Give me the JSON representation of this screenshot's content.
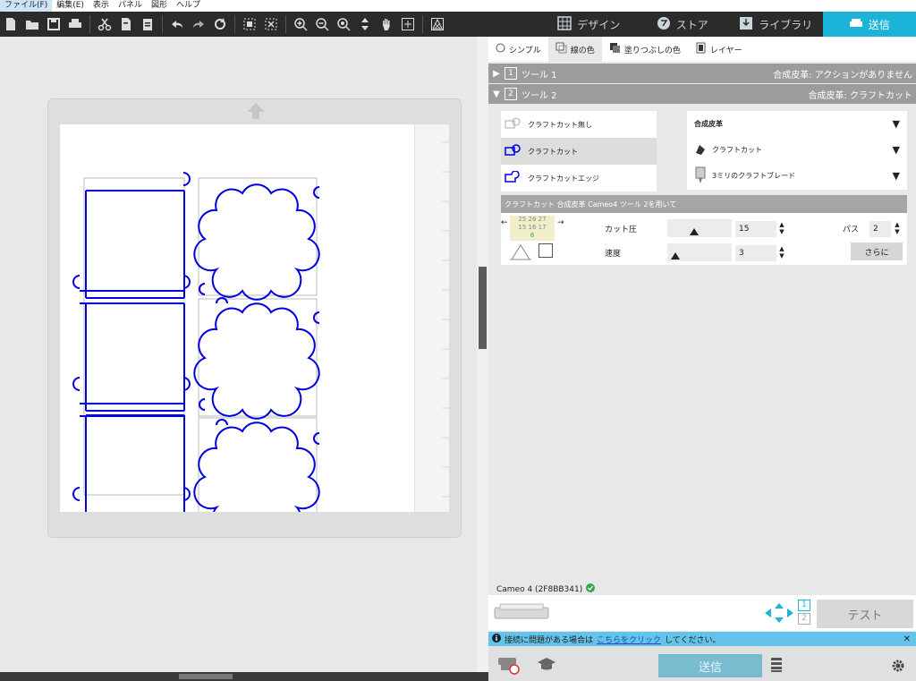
{
  "menu": [
    "ファイル(F)",
    "編集(E)",
    "表示",
    "パネル",
    "図形",
    "ヘルプ"
  ],
  "nav": {
    "design": "デザイン",
    "store": "ストア",
    "library": "ライブラリ",
    "send": "送信"
  },
  "panel_tabs": {
    "simple": "シンプル",
    "line_color": "線の色",
    "fill_color": "塗りつぶしの色",
    "layer": "レイヤー"
  },
  "tools": [
    {
      "number": "1",
      "label": "ツール 1",
      "status": "合成皮革: アクションがありません"
    },
    {
      "number": "2",
      "label": "ツール 2",
      "status": "合成皮革: クラフトカット"
    }
  ],
  "cut_options": [
    "クラフトカット無し",
    "クラフトカット",
    "クラフトカットエッジ"
  ],
  "material": {
    "name": "合成皮革",
    "action": "クラフトカット",
    "blade": "3ミリのクラフトブレード"
  },
  "settings": {
    "header": "クラフトカット 合成皮革 Cameo4 ツール 2を用いて",
    "grid_row1": "25 26 27",
    "grid_row2": "15 16 17",
    "grid_row3": "6",
    "force_label": "カット圧",
    "force_value": "15",
    "force_level": 0.15,
    "speed_label": "速度",
    "speed_value": "3",
    "speed_level": 0.05,
    "pass_label": "パス",
    "pass_value": "2",
    "more": "さらに"
  },
  "device": {
    "name": "Cameo 4 (2F8BB341)",
    "tool1": "1",
    "tool2": "2",
    "test": "テスト"
  },
  "info": {
    "text": "接続に問題がある場合は",
    "link": "こちらをクリック",
    "suffix": "してください。"
  },
  "send_button": "送信",
  "colors": {
    "accent": "#1cb3d8",
    "toolbar": "#2b2b2b",
    "cut_line": "#0000e0",
    "info": "#63c3ea"
  }
}
